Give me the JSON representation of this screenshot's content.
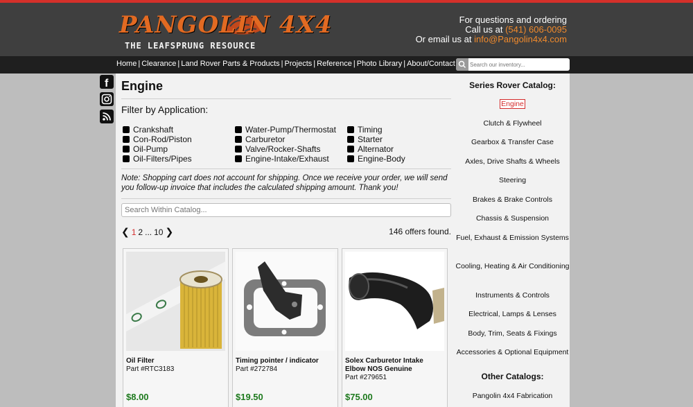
{
  "brand": {
    "logo_main": "PANGOLIN 4X4",
    "logo_sub": "THE LEAFSPRUNG RESOURCE",
    "accent": "#e26a22"
  },
  "contact": {
    "line1": "For questions and ordering",
    "call_prefix": "Call us at",
    "phone": "(541) 606-0095",
    "email_prefix": "Or email us at",
    "email": "info@Pangolin4x4.com"
  },
  "nav": {
    "items": [
      "Home",
      "Clearance",
      "Land Rover Parts & Products",
      "Projects",
      "Reference",
      "Photo Library",
      "About/Contact"
    ],
    "search_placeholder": "Search our inventory..."
  },
  "social": [
    "facebook-icon",
    "instagram-icon",
    "rss-icon"
  ],
  "page": {
    "title": "Engine",
    "filter_title": "Filter by Application:",
    "filters": {
      "col1": [
        "Crankshaft",
        "Con-Rod/Piston",
        "Oil-Pump",
        "Oil-Filters/Pipes"
      ],
      "col2": [
        "Water-Pump/Thermostat",
        "Carburetor",
        "Valve/Rocker-Shafts",
        "Engine-Intake/Exhaust"
      ],
      "col3": [
        "Timing",
        "Starter",
        "Alternator",
        "Engine-Body"
      ]
    },
    "note": "Note: Shopping cart does not account for shipping. Once we receive your order, we will send you follow-up invoice that includes the calculated shipping amount. Thank you!",
    "catalog_search_placeholder": "Search Within Catalog...",
    "pager": {
      "current": "1",
      "next": "2",
      "ellipsis": "...",
      "last": "10"
    },
    "offers_count": "146 offers found."
  },
  "products": [
    {
      "name": "Oil Filter",
      "part": "Part #RTC3183",
      "price": "$8.00"
    },
    {
      "name": "Timing pointer / indicator",
      "part": "Part #272784",
      "price": "$19.50"
    },
    {
      "name": "Solex Carburetor Intake Elbow NOS Genuine",
      "part": "Part #279651",
      "price": "$75.00"
    }
  ],
  "sidebar": {
    "title": "Series Rover Catalog:",
    "items": [
      "Engine",
      "Clutch & Flywheel",
      "Gearbox & Transfer Case",
      "Axles, Drive Shafts & Wheels",
      "Steering",
      "Brakes & Brake Controls",
      "Chassis & Suspension",
      "Fuel, Exhaust & Emission Systems",
      "Cooling, Heating & Air Conditioning",
      "Instruments & Controls",
      "Electrical, Lamps & Lenses",
      "Body, Trim, Seats & Fixings",
      "Accessories & Optional Equipment"
    ],
    "other_title": "Other Catalogs:",
    "other_items": [
      "Pangolin 4x4 Fabrication"
    ]
  }
}
